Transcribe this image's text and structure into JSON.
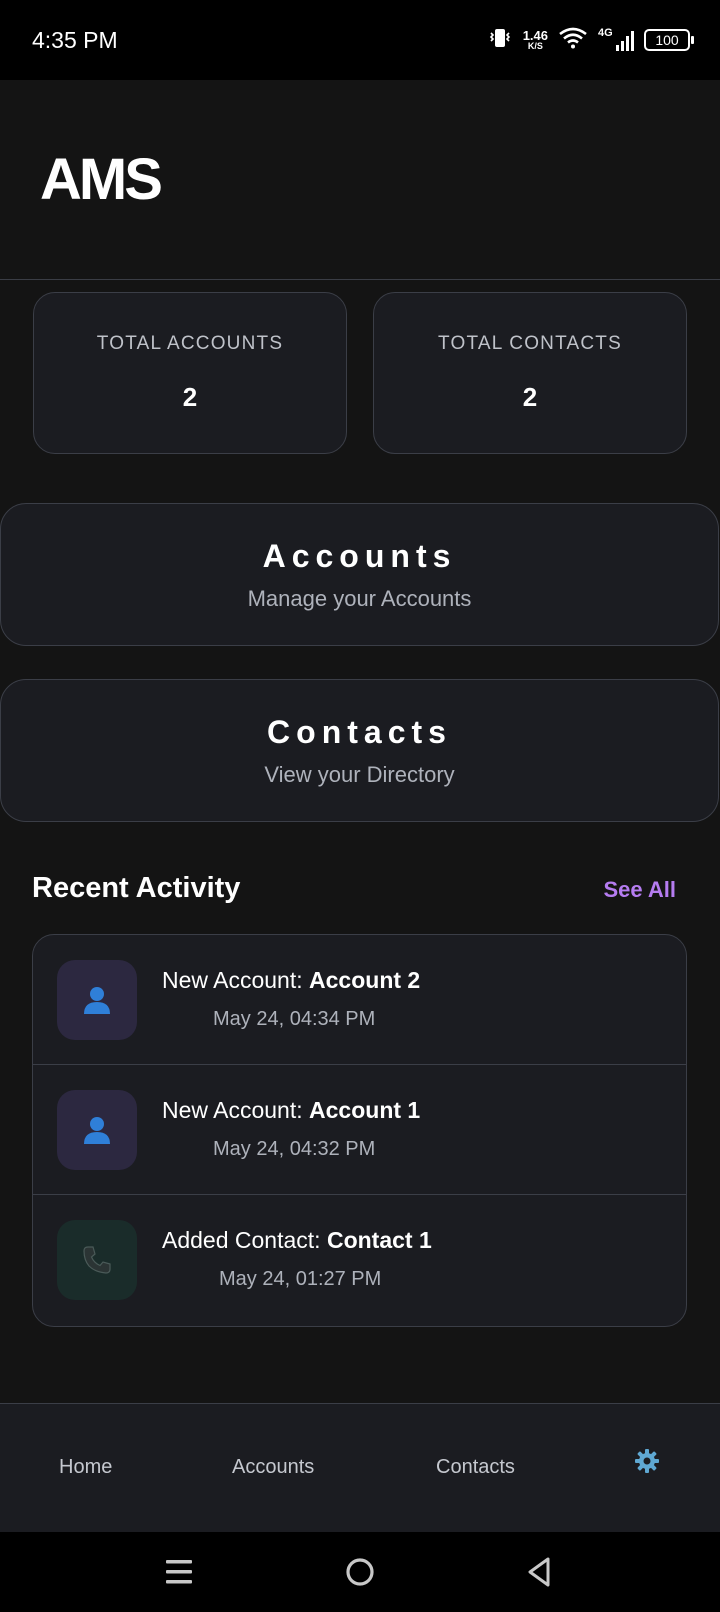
{
  "status_bar": {
    "time": "4:35 PM",
    "net_speed_value": "1.46",
    "net_speed_unit": "K/S",
    "network_type": "4G",
    "battery": "100",
    "icons": [
      "vibrate-icon",
      "wifi-icon",
      "signal-icon",
      "battery-icon"
    ]
  },
  "header": {
    "title": "AMS"
  },
  "stats": [
    {
      "label": "TOTAL ACCOUNTS",
      "value": "2"
    },
    {
      "label": "TOTAL CONTACTS",
      "value": "2"
    }
  ],
  "nav_cards": [
    {
      "title": "Accounts",
      "subtitle": "Manage your Accounts"
    },
    {
      "title": "Contacts",
      "subtitle": "View your Directory"
    }
  ],
  "recent_activity": {
    "title": "Recent Activity",
    "see_all": "See All",
    "items": [
      {
        "icon": "person-icon",
        "prefix": "New Account: ",
        "name": "Account 2",
        "time": "May 24, 04:34 PM"
      },
      {
        "icon": "person-icon",
        "prefix": "New Account: ",
        "name": "Account 1",
        "time": "May 24, 04:32 PM"
      },
      {
        "icon": "phone-icon",
        "prefix": "Added Contact: ",
        "name": "Contact 1",
        "time": "May 24, 01:27 PM"
      }
    ]
  },
  "bottom_nav": {
    "items": [
      "Home",
      "Accounts",
      "Contacts"
    ],
    "settings_icon": "gear-icon"
  },
  "system_nav": [
    "menu-icon",
    "home-circle-icon",
    "back-icon"
  ],
  "colors": {
    "background": "#141414",
    "card": "#1b1c21",
    "border": "#3b3e47",
    "accent": "#b57cf0",
    "gear": "#5fa8d3",
    "person_icon": "#2f7fd8"
  }
}
